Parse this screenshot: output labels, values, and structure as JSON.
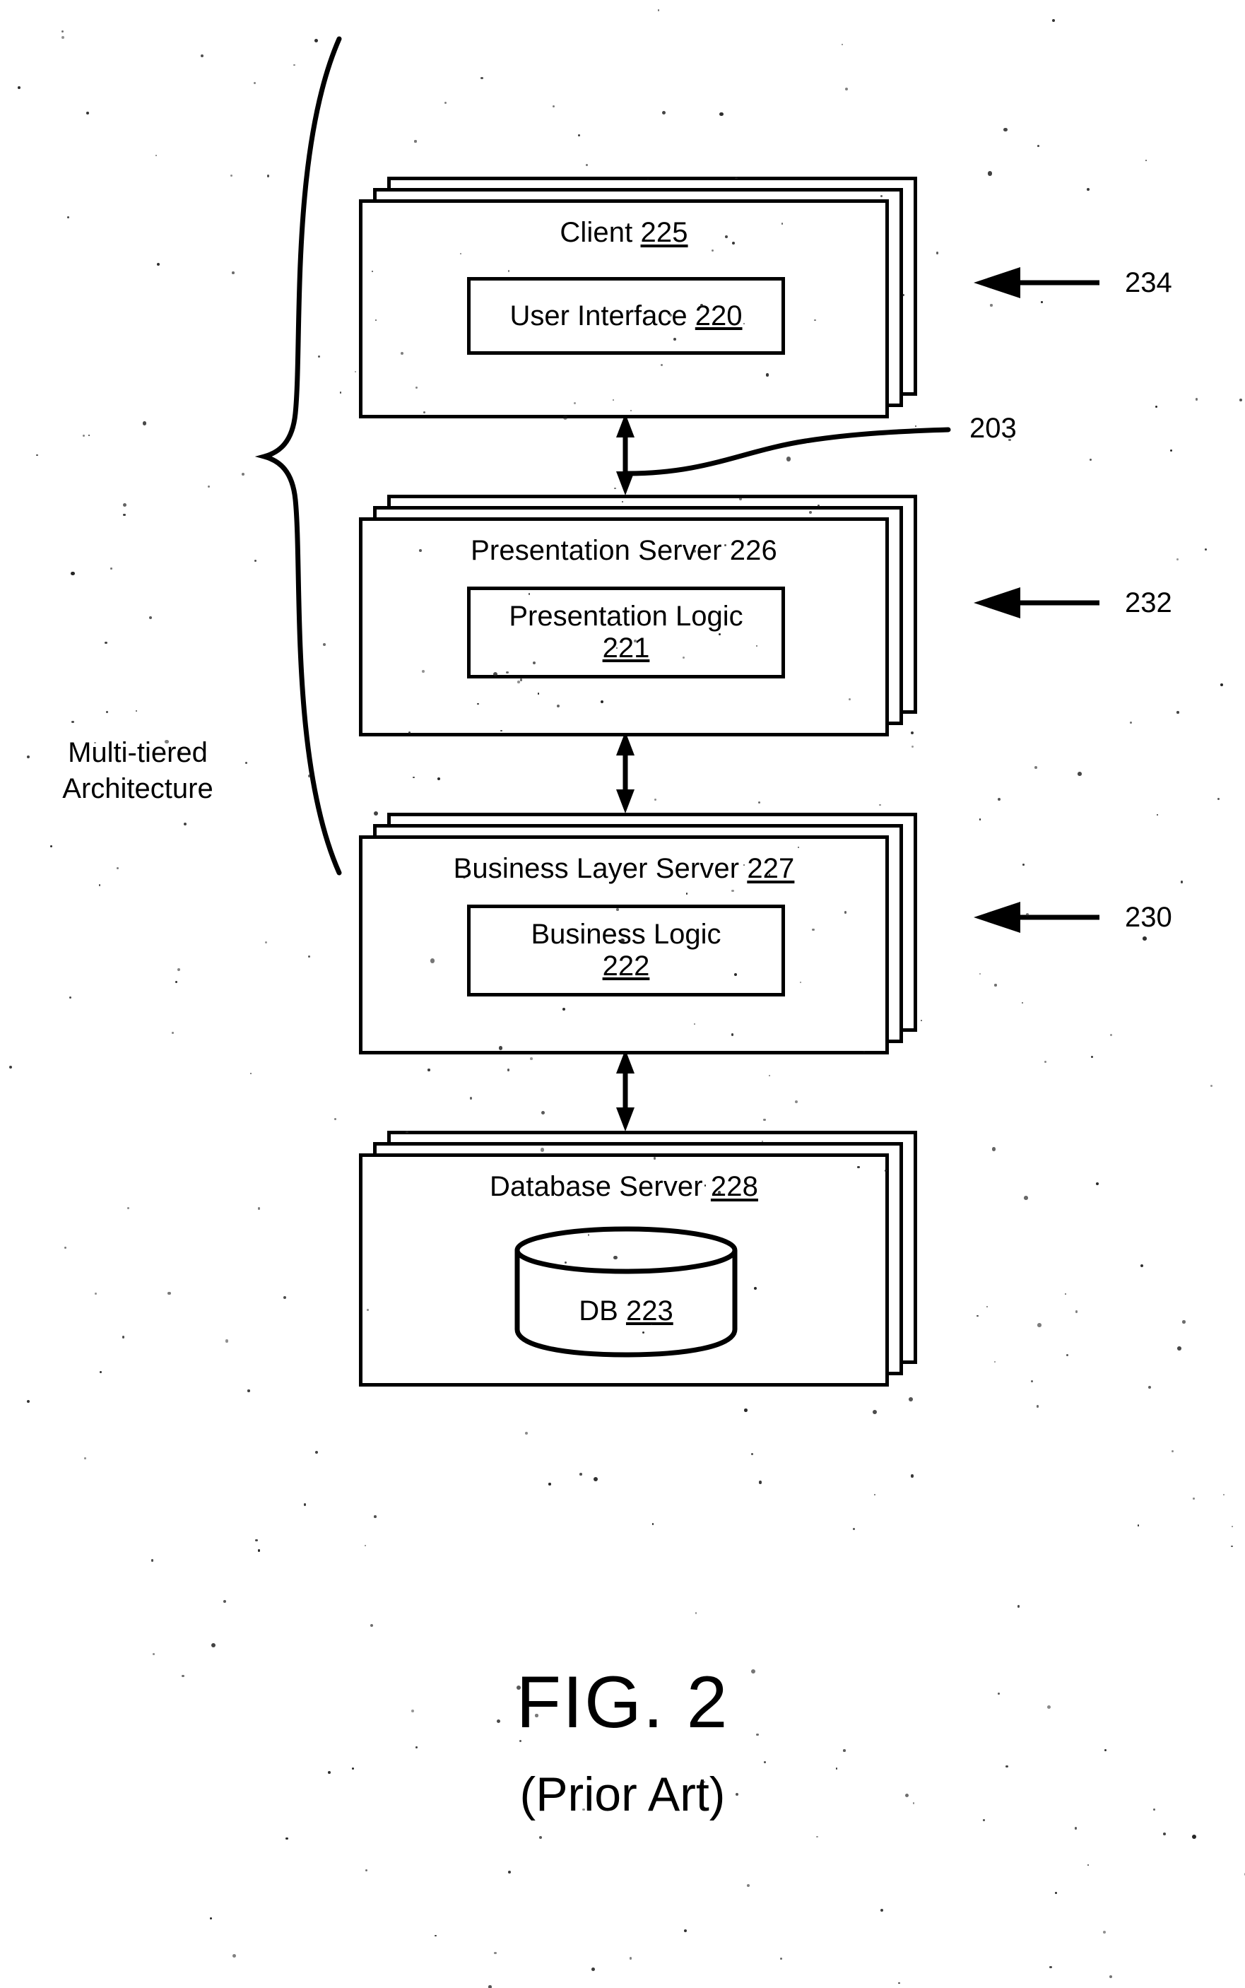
{
  "figure": {
    "caption": "FIG. 2",
    "subcaption": "(Prior Art)"
  },
  "brace": {
    "label_line1": "Multi-tiered",
    "label_line2": "Architecture"
  },
  "tiers": [
    {
      "id": "client",
      "title_text": "Client ",
      "title_num": "225",
      "title_num_underlined": true,
      "inner": {
        "line1": "User Interface ",
        "num": "220",
        "num_underlined": true,
        "num_on_new_line": false
      },
      "callout": "234"
    },
    {
      "id": "presentation-server",
      "title_text": "Presentation Server ",
      "title_num": "226",
      "title_num_underlined": false,
      "inner": {
        "line1": "Presentation Logic",
        "num": "221",
        "num_underlined": true,
        "num_on_new_line": true
      },
      "callout": "232"
    },
    {
      "id": "business-layer-server",
      "title_text": "Business Layer Server ",
      "title_num": "227",
      "title_num_underlined": true,
      "inner": {
        "line1": "Business Logic",
        "num": "222",
        "num_underlined": true,
        "num_on_new_line": true
      },
      "callout": "230"
    },
    {
      "id": "database-server",
      "title_text": "Database Server ",
      "title_num": "228",
      "title_num_underlined": true,
      "inner": {
        "line1": "DB ",
        "num": "223",
        "num_underlined": true,
        "num_on_new_line": false
      },
      "callout": ""
    }
  ],
  "connectors": {
    "leader_203": "203",
    "arrow_style": "double-headed-vertical"
  },
  "colors": {
    "ink": "#000000",
    "paper": "#ffffff"
  }
}
